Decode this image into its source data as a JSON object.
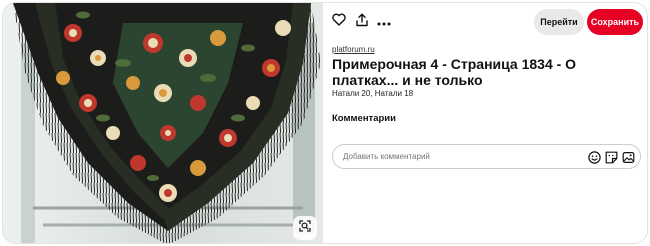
{
  "image": {
    "alt": "",
    "colors": {
      "shawl": "#1c1d1a",
      "fringe": "#0e0f0d",
      "background_window": "#dfe6e2",
      "flower_red": "#c0372e",
      "flower_cream": "#eadcb6",
      "flower_orange": "#d89a3b",
      "leaf_green": "#4f6b3a"
    }
  },
  "toolbar": {
    "like_icon": "heart-icon",
    "share_icon": "share-icon",
    "more_icon": "more-icon",
    "go_label": "Перейти",
    "save_label": "Сохранить"
  },
  "pin": {
    "source": "platforum.ru",
    "title": "Примерочная 4 - Страница 1834 - О платках... и не только",
    "authors": "Натали 20, Натали 18"
  },
  "comments": {
    "heading": "Комментарии",
    "placeholder": "Добавить комментарий",
    "emoji_icon": "emoji-icon",
    "sticker_icon": "sticker-icon",
    "image_icon": "image-icon"
  },
  "colors": {
    "accent": "#e60023",
    "secondary_button": "#e9e9e9"
  }
}
